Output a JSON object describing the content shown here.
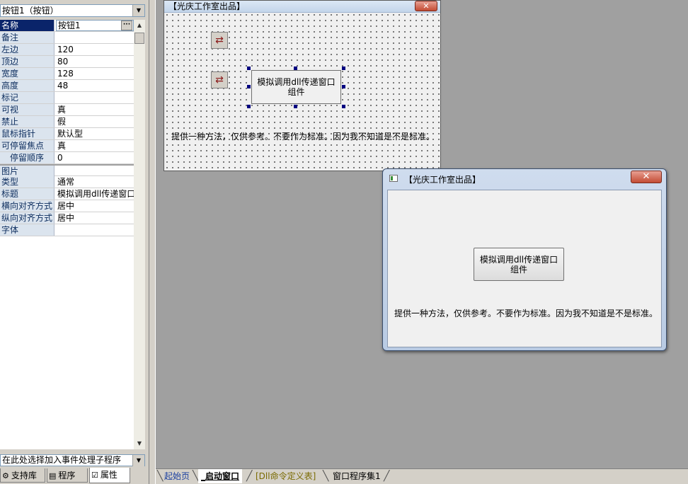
{
  "property_panel": {
    "object_select": "按钮1（按钮）",
    "properties": [
      {
        "name": "名称",
        "value": "按钮1"
      },
      {
        "name": "备注",
        "value": ""
      },
      {
        "name": "左边",
        "value": "120"
      },
      {
        "name": "顶边",
        "value": "80"
      },
      {
        "name": "宽度",
        "value": "128"
      },
      {
        "name": "高度",
        "value": "48"
      },
      {
        "name": "标记",
        "value": ""
      },
      {
        "name": "可视",
        "value": "真"
      },
      {
        "name": "禁止",
        "value": "假"
      },
      {
        "name": "鼠标指针",
        "value": "默认型"
      },
      {
        "name": "可停留焦点",
        "value": "真"
      },
      {
        "name": "停留顺序",
        "value": "0"
      },
      {
        "name": "图片",
        "value": ""
      },
      {
        "name": "类型",
        "value": "通常"
      },
      {
        "name": "标题",
        "value": "模拟调用dll传递窗口组件"
      },
      {
        "name": "横向对齐方式",
        "value": "居中"
      },
      {
        "name": "纵向对齐方式",
        "value": "居中"
      },
      {
        "name": "字体",
        "value": ""
      }
    ],
    "ellipsis": "···",
    "event_select": "在此处选择加入事件处理子程序",
    "tabs": [
      {
        "label": "支持库",
        "icon": "support-library-icon"
      },
      {
        "label": "程序",
        "icon": "program-icon"
      },
      {
        "label": "属性",
        "icon": "properties-icon"
      }
    ]
  },
  "design_form": {
    "title": "【光庆工作室出品】",
    "close": "✕",
    "button_line1": "模拟调用dll传递窗口",
    "button_line2": "组件",
    "label": "提供一种方法，仅供参考。不要作为标准。因为我不知道是不是标准。"
  },
  "run_window": {
    "title": "【光庆工作室出品】",
    "close": "✕",
    "button_line1": "模拟调用dll传递窗口",
    "button_line2": "组件",
    "label": "提供一种方法，仅供参考。不要作为标准。因为我不知道是不是标准。"
  },
  "bottom_tabs": [
    {
      "label": "起始页"
    },
    {
      "label": "_启动窗口"
    },
    {
      "label": "[Dll命令定义表]"
    },
    {
      "label": "窗口程序集1"
    }
  ]
}
